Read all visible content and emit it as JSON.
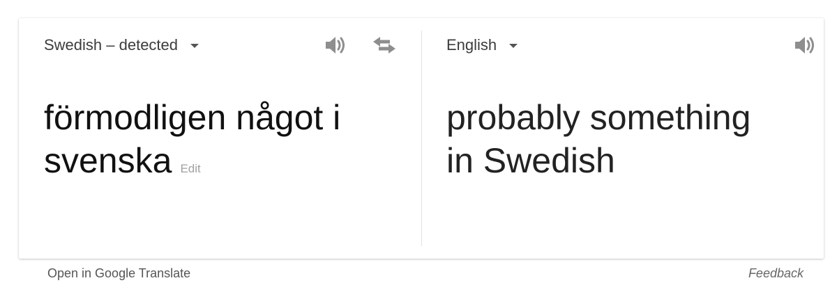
{
  "source": {
    "language_label": "Swedish – detected",
    "text_line1": "förmodligen något i",
    "text_line2": "svenska",
    "edit_label": "Edit",
    "speaker_icon": "speaker-icon",
    "swap_icon": "swap-languages-icon"
  },
  "target": {
    "language_label": "English",
    "text_line1": "probably something",
    "text_line2": "in Swedish",
    "speaker_icon": "speaker-icon"
  },
  "footer": {
    "open_link": "Open in Google Translate",
    "feedback_link": "Feedback"
  },
  "colors": {
    "icon_gray": "#8e8e8e",
    "text": "#222222",
    "muted": "#a0a0a0"
  }
}
